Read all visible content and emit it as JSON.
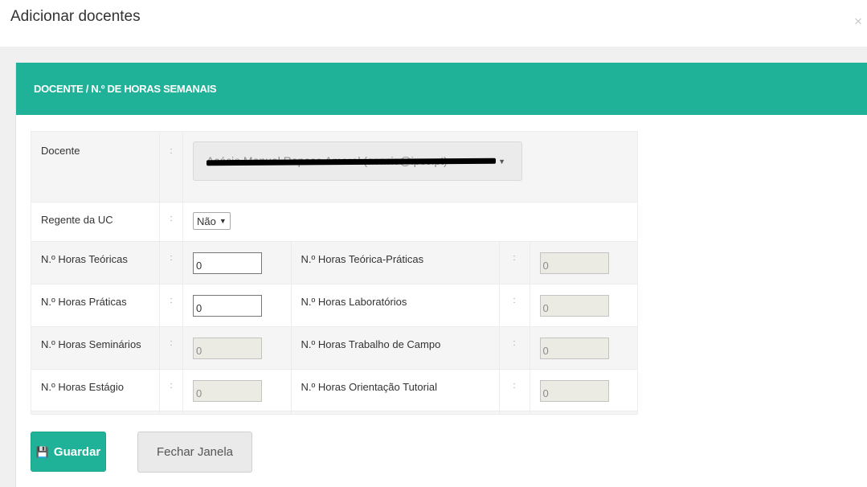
{
  "modal": {
    "title": "Adicionar docentes",
    "close_glyph": "×"
  },
  "panel": {
    "title": "DOCENTE / N.º DE HORAS SEMANAIS"
  },
  "form": {
    "colon": ":",
    "docente": {
      "label": "Docente",
      "value": "Acácio Manuel Raposo Amaral (acacio@ipcc.pt)",
      "redacted": true
    },
    "regente": {
      "label": "Regente da UC",
      "value": "Não",
      "caret": "▼"
    },
    "rows": [
      {
        "left": {
          "label": "N.º Horas Teóricas",
          "value": "0",
          "disabled": false
        },
        "right": {
          "label": "N.º Horas Teórica-Práticas",
          "value": "0",
          "disabled": true
        }
      },
      {
        "left": {
          "label": "N.º Horas Práticas",
          "value": "0",
          "disabled": false
        },
        "right": {
          "label": "N.º Horas Laboratórios",
          "value": "0",
          "disabled": true
        }
      },
      {
        "left": {
          "label": "N.º Horas Seminários",
          "value": "0",
          "disabled": true
        },
        "right": {
          "label": "N.º Horas Trabalho de Campo",
          "value": "0",
          "disabled": true
        }
      },
      {
        "left": {
          "label": "N.º Horas Estágio",
          "value": "0",
          "disabled": true
        },
        "right": {
          "label": "N.º Horas Orientação Tutorial",
          "value": "0",
          "disabled": true
        }
      }
    ]
  },
  "buttons": {
    "save_label": "Guardar",
    "save_icon": "floppy-disk-icon",
    "close_label": "Fechar Janela"
  },
  "colors": {
    "accent": "#1fb298",
    "page_bg": "#f0f0f0"
  }
}
